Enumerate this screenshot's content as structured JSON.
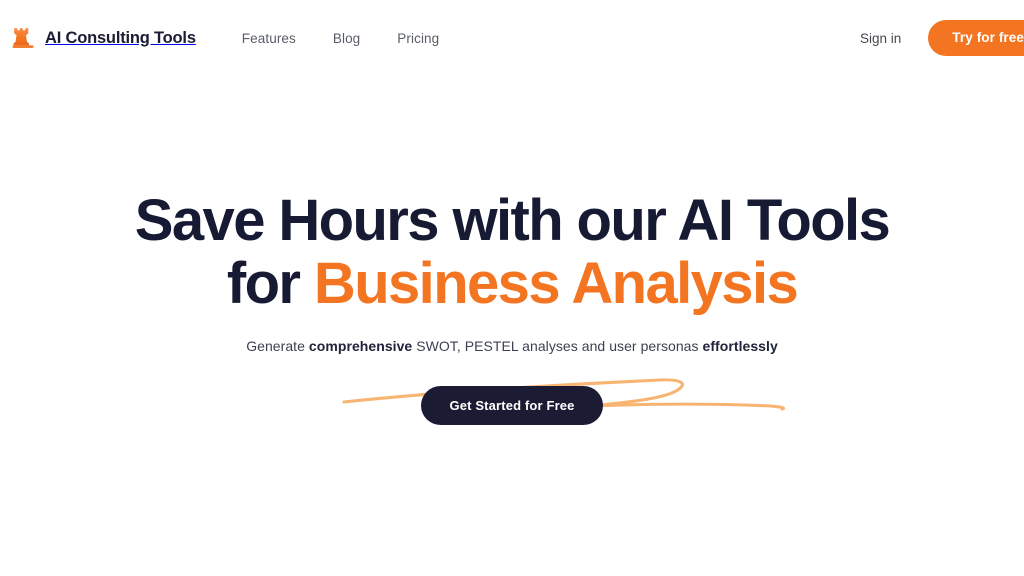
{
  "header": {
    "brand": {
      "icon": "chess-rook-icon",
      "name": "AI Consulting Tools"
    },
    "nav_items": [
      {
        "label": "Features"
      },
      {
        "label": "Blog"
      },
      {
        "label": "Pricing"
      }
    ],
    "sign_in_label": "Sign in",
    "try_free_label": "Try for free"
  },
  "hero": {
    "heading_line1": "Save Hours with our AI Tools",
    "heading_line2_prefix": "for ",
    "heading_line2_accent": "Business Analysis",
    "subtitle_part1": "Generate ",
    "subtitle_bold1": "comprehensive",
    "subtitle_part2": " SWOT, PESTEL analyses and user personas ",
    "subtitle_bold2": "effortlessly",
    "cta_label": "Get Started for Free"
  },
  "colors": {
    "brand_orange": "#f47521",
    "swoosh_orange": "#f8b471",
    "dark_navy": "#1b1c33",
    "nav_grey": "#585d68",
    "background": "#ffffff"
  }
}
